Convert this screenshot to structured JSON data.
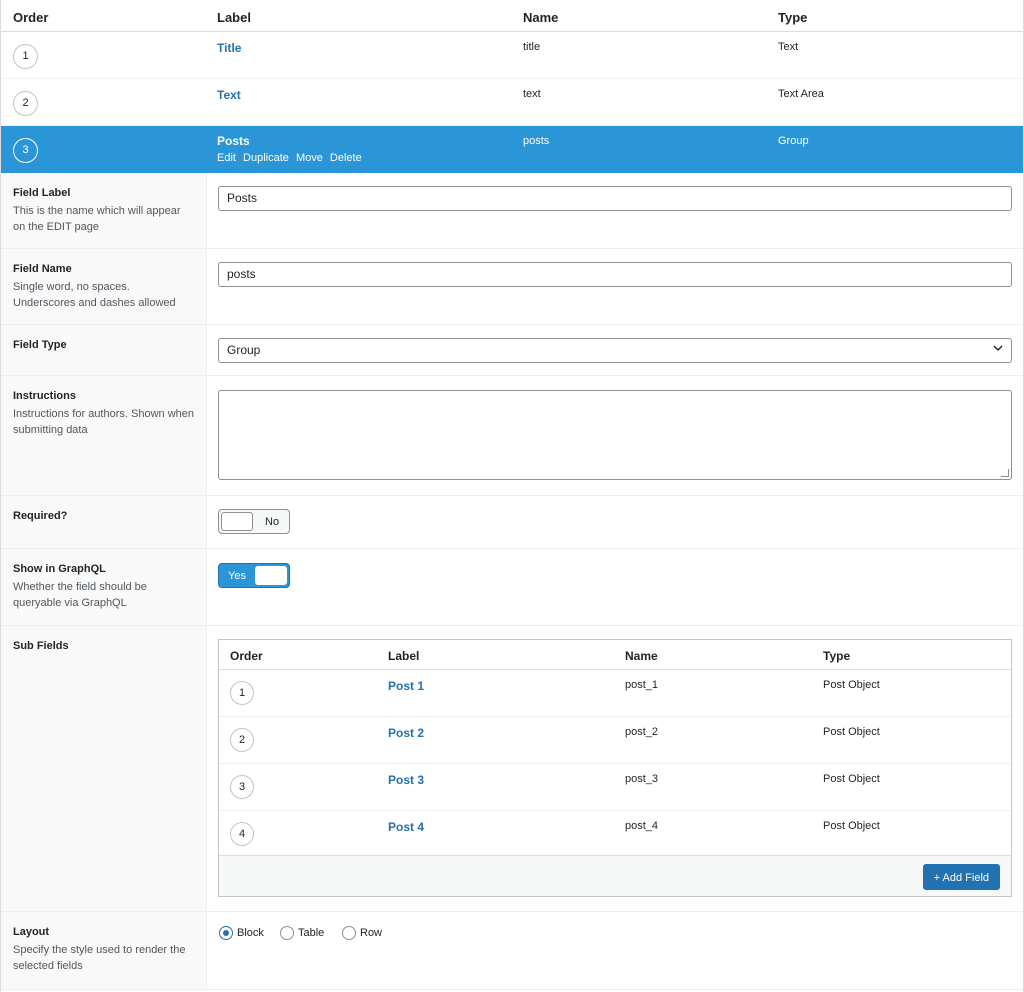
{
  "list": {
    "headers": {
      "order": "Order",
      "label": "Label",
      "name": "Name",
      "type": "Type"
    },
    "rows": [
      {
        "order": "1",
        "label": "Title",
        "name": "title",
        "type": "Text"
      },
      {
        "order": "2",
        "label": "Text",
        "name": "text",
        "type": "Text Area"
      },
      {
        "order": "3",
        "label": "Posts",
        "name": "posts",
        "type": "Group"
      }
    ],
    "actions": {
      "edit": "Edit",
      "duplicate": "Duplicate",
      "move": "Move",
      "delete": "Delete"
    }
  },
  "settings": {
    "field_label": {
      "title": "Field Label",
      "desc": "This is the name which will appear on the EDIT page",
      "value": "Posts"
    },
    "field_name": {
      "title": "Field Name",
      "desc": "Single word, no spaces. Underscores and dashes allowed",
      "value": "posts"
    },
    "field_type": {
      "title": "Field Type",
      "value": "Group"
    },
    "instructions": {
      "title": "Instructions",
      "desc": "Instructions for authors. Shown when submitting data",
      "value": ""
    },
    "required": {
      "title": "Required?",
      "state": "No"
    },
    "graphql": {
      "title": "Show in GraphQL",
      "desc": "Whether the field should be queryable via GraphQL",
      "state": "Yes"
    },
    "sub_fields": {
      "title": "Sub Fields",
      "headers": {
        "order": "Order",
        "label": "Label",
        "name": "Name",
        "type": "Type"
      },
      "rows": [
        {
          "order": "1",
          "label": "Post 1",
          "name": "post_1",
          "type": "Post Object"
        },
        {
          "order": "2",
          "label": "Post 2",
          "name": "post_2",
          "type": "Post Object"
        },
        {
          "order": "3",
          "label": "Post 3",
          "name": "post_3",
          "type": "Post Object"
        },
        {
          "order": "4",
          "label": "Post 4",
          "name": "post_4",
          "type": "Post Object"
        }
      ],
      "add_button": "+ Add Field"
    },
    "layout": {
      "title": "Layout",
      "desc": "Specify the style used to render the selected fields",
      "options": [
        "Block",
        "Table",
        "Row"
      ],
      "selected": "Block"
    }
  },
  "colors": {
    "accent": "#2a95d7",
    "link": "#2271b1",
    "button": "#2271b1"
  }
}
